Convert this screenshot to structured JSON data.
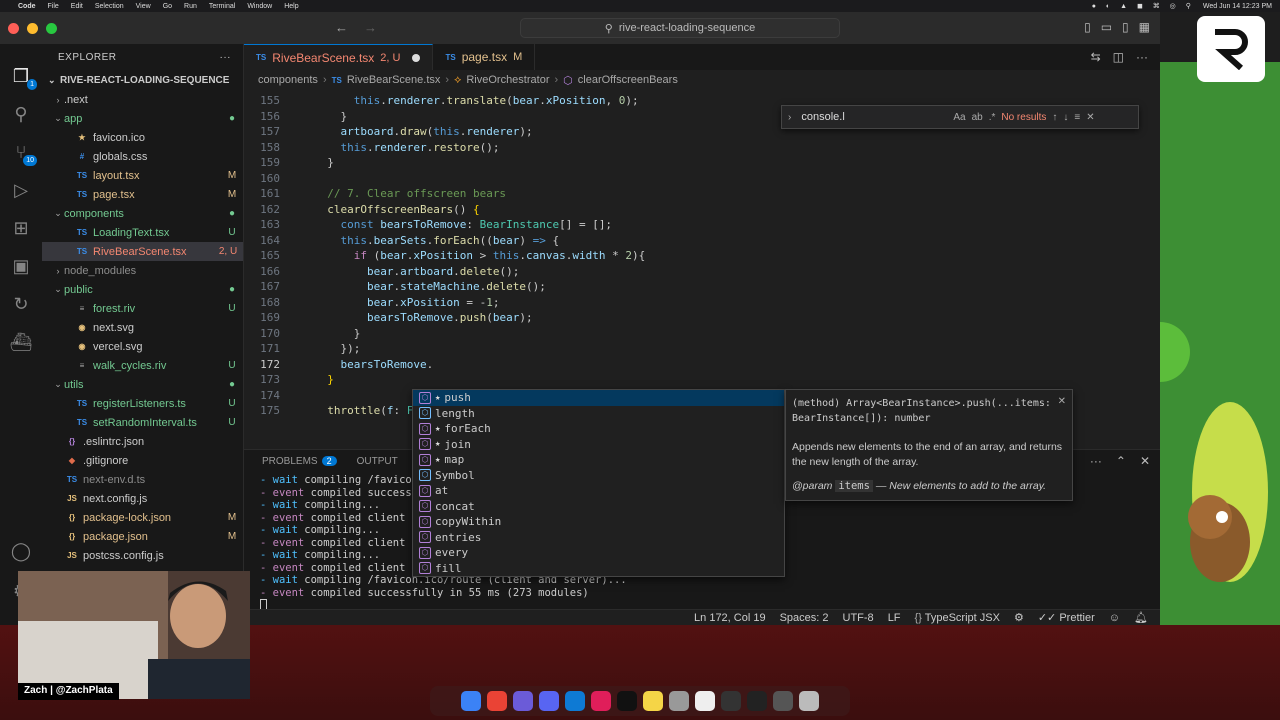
{
  "menubar": {
    "app": "Code",
    "items": [
      "File",
      "Edit",
      "Selection",
      "View",
      "Go",
      "Run",
      "Terminal",
      "Window",
      "Help"
    ],
    "datetime": "Wed Jun 14  12:23 PM"
  },
  "window": {
    "command_center": "rive-react-loading-sequence"
  },
  "activity": {
    "source_control_badge": "10",
    "explorer_badge": "1"
  },
  "sidebar": {
    "title": "EXPLORER",
    "project": "RIVE-REACT-LOADING-SEQUENCE",
    "tree": [
      {
        "label": ".next",
        "indent": 1,
        "chev": "›",
        "icon": "",
        "status": "",
        "color": "#ccc"
      },
      {
        "label": "app",
        "indent": 1,
        "chev": "⌄",
        "icon": "",
        "status": "●",
        "color": "#73c991"
      },
      {
        "label": "favicon.ico",
        "indent": 2,
        "chev": "",
        "icon": "★",
        "status": "",
        "color": "#ccc",
        "iconcolor": "#e5c07b"
      },
      {
        "label": "globals.css",
        "indent": 2,
        "chev": "",
        "icon": "#",
        "status": "",
        "color": "#ccc",
        "iconcolor": "#3b8eea"
      },
      {
        "label": "layout.tsx",
        "indent": 2,
        "chev": "",
        "icon": "TS",
        "status": "M",
        "color": "#e2c08d",
        "iconcolor": "#3b8eea"
      },
      {
        "label": "page.tsx",
        "indent": 2,
        "chev": "",
        "icon": "TS",
        "status": "M",
        "color": "#e2c08d",
        "iconcolor": "#3b8eea"
      },
      {
        "label": "components",
        "indent": 1,
        "chev": "⌄",
        "icon": "",
        "status": "●",
        "color": "#73c991"
      },
      {
        "label": "LoadingText.tsx",
        "indent": 2,
        "chev": "",
        "icon": "TS",
        "status": "U",
        "color": "#73c991",
        "iconcolor": "#3b8eea"
      },
      {
        "label": "RiveBearScene.tsx",
        "indent": 2,
        "chev": "",
        "icon": "TS",
        "status": "2, U",
        "color": "#f48771",
        "iconcolor": "#3b8eea",
        "selected": true
      },
      {
        "label": "node_modules",
        "indent": 1,
        "chev": "›",
        "icon": "",
        "status": "",
        "color": "#8c8c8c"
      },
      {
        "label": "public",
        "indent": 1,
        "chev": "⌄",
        "icon": "",
        "status": "●",
        "color": "#73c991"
      },
      {
        "label": "forest.riv",
        "indent": 2,
        "chev": "",
        "icon": "≡",
        "status": "U",
        "color": "#73c991",
        "iconcolor": "#aaa"
      },
      {
        "label": "next.svg",
        "indent": 2,
        "chev": "",
        "icon": "◉",
        "status": "",
        "color": "#ccc",
        "iconcolor": "#e5c07b"
      },
      {
        "label": "vercel.svg",
        "indent": 2,
        "chev": "",
        "icon": "◉",
        "status": "",
        "color": "#ccc",
        "iconcolor": "#e5c07b"
      },
      {
        "label": "walk_cycles.riv",
        "indent": 2,
        "chev": "",
        "icon": "≡",
        "status": "U",
        "color": "#73c991",
        "iconcolor": "#aaa"
      },
      {
        "label": "utils",
        "indent": 1,
        "chev": "⌄",
        "icon": "",
        "status": "●",
        "color": "#73c991"
      },
      {
        "label": "registerListeners.ts",
        "indent": 2,
        "chev": "",
        "icon": "TS",
        "status": "U",
        "color": "#73c991",
        "iconcolor": "#3b8eea"
      },
      {
        "label": "setRandomInterval.ts",
        "indent": 2,
        "chev": "",
        "icon": "TS",
        "status": "U",
        "color": "#73c991",
        "iconcolor": "#3b8eea"
      },
      {
        "label": ".eslintrc.json",
        "indent": 1,
        "chev": "",
        "icon": "{}",
        "status": "",
        "color": "#ccc",
        "iconcolor": "#b180d7"
      },
      {
        "label": ".gitignore",
        "indent": 1,
        "chev": "",
        "icon": "◆",
        "status": "",
        "color": "#ccc",
        "iconcolor": "#e06c4b"
      },
      {
        "label": "next-env.d.ts",
        "indent": 1,
        "chev": "",
        "icon": "TS",
        "status": "",
        "color": "#8c8c8c",
        "iconcolor": "#3b8eea"
      },
      {
        "label": "next.config.js",
        "indent": 1,
        "chev": "",
        "icon": "JS",
        "status": "",
        "color": "#ccc",
        "iconcolor": "#e5c07b"
      },
      {
        "label": "package-lock.json",
        "indent": 1,
        "chev": "",
        "icon": "{}",
        "status": "M",
        "color": "#e2c08d",
        "iconcolor": "#e5c07b"
      },
      {
        "label": "package.json",
        "indent": 1,
        "chev": "",
        "icon": "{}",
        "status": "M",
        "color": "#e2c08d",
        "iconcolor": "#e5c07b"
      },
      {
        "label": "postcss.config.js",
        "indent": 1,
        "chev": "",
        "icon": "JS",
        "status": "",
        "color": "#ccc",
        "iconcolor": "#e5c07b"
      }
    ]
  },
  "tabs": [
    {
      "label": "RiveBearScene.tsx",
      "suffix": "2, U",
      "active": true
    },
    {
      "label": "page.tsx",
      "suffix": "M",
      "active": false
    }
  ],
  "breadcrumb": [
    "components",
    "RiveBearScene.tsx",
    "RiveOrchestrator",
    "clearOffscreenBears"
  ],
  "find": {
    "query": "console.l",
    "result": "No results"
  },
  "code_lines": [
    {
      "n": "155",
      "html": "      <span class=\"kw\">this</span>.<span class=\"vr\">renderer</span>.<span class=\"fn\">translate</span>(<span class=\"vr\">bear</span>.<span class=\"vr\">xPosition</span>, <span class=\"nm\">0</span>);"
    },
    {
      "n": "156",
      "html": "    }"
    },
    {
      "n": "157",
      "html": "    <span class=\"vr\">artboard</span>.<span class=\"fn\">draw</span>(<span class=\"kw\">this</span>.<span class=\"vr\">renderer</span>);"
    },
    {
      "n": "158",
      "html": "    <span class=\"kw\">this</span>.<span class=\"vr\">renderer</span>.<span class=\"fn\">restore</span>();"
    },
    {
      "n": "159",
      "html": "  }"
    },
    {
      "n": "160",
      "html": ""
    },
    {
      "n": "161",
      "html": "  <span class=\"cm\">// 7. Clear offscreen bears</span>"
    },
    {
      "n": "162",
      "html": "  <span class=\"fn\">clearOffscreenBears</span>() <span class=\"br\">{</span>"
    },
    {
      "n": "163",
      "html": "    <span class=\"kw\">const</span> <span class=\"vr\">bearsToRemove</span>: <span class=\"ty\">BearInstance</span>[] = [];"
    },
    {
      "n": "164",
      "html": "    <span class=\"kw\">this</span>.<span class=\"vr\">bearSets</span>.<span class=\"fn\">forEach</span>((<span class=\"vr\">bear</span>) <span class=\"kw\">=&gt;</span> {"
    },
    {
      "n": "165",
      "html": "      <span class=\"ctl\">if</span> (<span class=\"vr\">bear</span>.<span class=\"vr\">xPosition</span> &gt; <span class=\"kw\">this</span>.<span class=\"vr\">canvas</span>.<span class=\"vr\">width</span> * <span class=\"nm\">2</span>){"
    },
    {
      "n": "166",
      "html": "        <span class=\"vr\">bear</span>.<span class=\"vr\">artboard</span>.<span class=\"fn\">delete</span>();"
    },
    {
      "n": "167",
      "html": "        <span class=\"vr\">bear</span>.<span class=\"vr\">stateMachine</span>.<span class=\"fn\">delete</span>();"
    },
    {
      "n": "168",
      "html": "        <span class=\"vr\">bear</span>.<span class=\"vr\">xPosition</span> = -<span class=\"nm\">1</span>;"
    },
    {
      "n": "169",
      "html": "        <span class=\"vr\">bearsToRemove</span>.<span class=\"fn\">push</span>(<span class=\"vr\">bear</span>);"
    },
    {
      "n": "170",
      "html": "      }"
    },
    {
      "n": "171",
      "html": "    });"
    },
    {
      "n": "172",
      "html": "    <span class=\"vr\">bearsToRemove</span>.",
      "current": true
    },
    {
      "n": "173",
      "html": "  <span class=\"br\">}</span>"
    },
    {
      "n": "174",
      "html": ""
    },
    {
      "n": "175",
      "html": "  <span class=\"fn\">throttle</span>(<span class=\"vr\">f</span>: <span class=\"ty\">Func</span>"
    }
  ],
  "suggest": [
    {
      "label": "push",
      "star": true,
      "kind": "method",
      "selected": true
    },
    {
      "label": "length",
      "star": false,
      "kind": "field"
    },
    {
      "label": "forEach",
      "star": true,
      "kind": "method"
    },
    {
      "label": "join",
      "star": true,
      "kind": "method"
    },
    {
      "label": "map",
      "star": true,
      "kind": "method"
    },
    {
      "label": "Symbol",
      "star": false,
      "kind": "field"
    },
    {
      "label": "at",
      "star": false,
      "kind": "method"
    },
    {
      "label": "concat",
      "star": false,
      "kind": "method"
    },
    {
      "label": "copyWithin",
      "star": false,
      "kind": "method"
    },
    {
      "label": "entries",
      "star": false,
      "kind": "method"
    },
    {
      "label": "every",
      "star": false,
      "kind": "method"
    },
    {
      "label": "fill",
      "star": false,
      "kind": "method"
    }
  ],
  "detail": {
    "signature": "(method) Array<BearInstance>.push(...items: BearInstance[]): number",
    "doc": "Appends new elements to the end of an array, and returns the new length of the array.",
    "param_tag": "@param",
    "param_name": "items",
    "param_desc": "— New elements to add to the array."
  },
  "panel": {
    "problems_label": "PROBLEMS",
    "problems_count": "2",
    "output_label": "OUTPUT",
    "terminal_lines": [
      {
        "kind": "wait",
        "text": " compiling /favicon"
      },
      {
        "kind": "event",
        "text": " compiled successfu"
      },
      {
        "kind": "wait",
        "text": " compiling..."
      },
      {
        "kind": "event",
        "text": " compiled client an"
      },
      {
        "kind": "wait",
        "text": " compiling..."
      },
      {
        "kind": "event",
        "text": " compiled client an"
      },
      {
        "kind": "wait",
        "text": " compiling..."
      },
      {
        "kind": "event",
        "text": " compiled client an"
      },
      {
        "kind": "wait",
        "text": " compiling /favicon.ico/route (client and server)..."
      },
      {
        "kind": "event",
        "text": " compiled successfully in 55 ms (273 modules)"
      }
    ]
  },
  "statusbar": {
    "position": "Ln 172, Col 19",
    "spaces": "Spaces: 2",
    "encoding": "UTF-8",
    "eol": "LF",
    "language": "TypeScript JSX",
    "formatter": "Prettier"
  },
  "webcam": {
    "label": "Zach | @ZachPlata"
  }
}
